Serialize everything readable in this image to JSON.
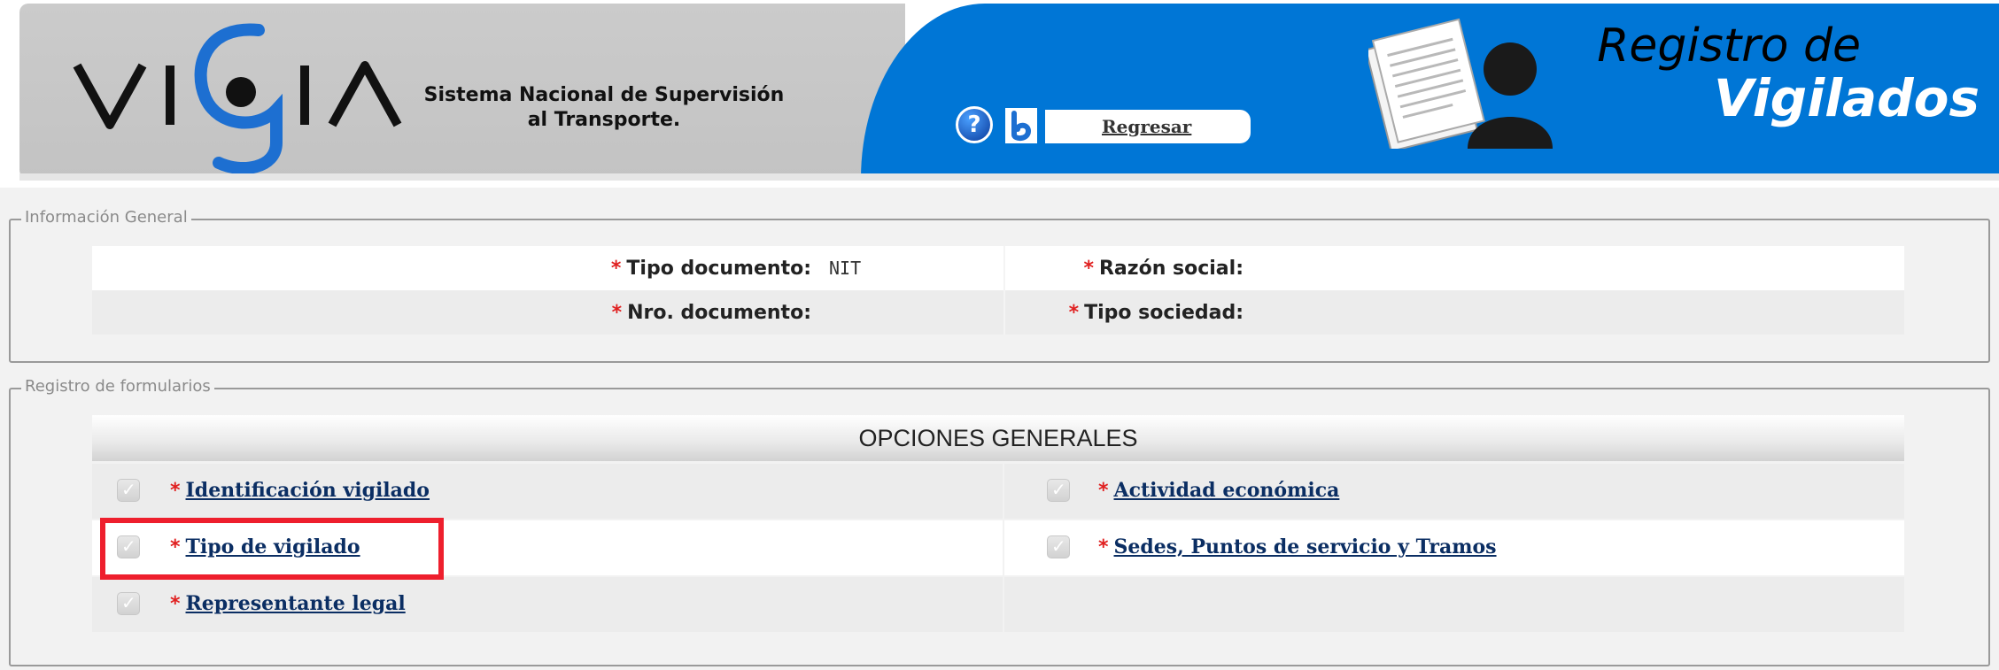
{
  "header": {
    "logo_text": "VIGIA",
    "system_title_line1": "Sistema Nacional de Supervisión",
    "system_title_line2": "al Transporte.",
    "help_label": "?",
    "back_label": "Regresar",
    "register_title_line1": "Registro de",
    "register_title_line2": "Vigilados",
    "colors": {
      "blue": "#0076d6",
      "gray": "#c7c7c7"
    },
    "icons": [
      "help-icon",
      "back-icon",
      "document-user-icon"
    ]
  },
  "info_general": {
    "legend": "Información General",
    "rows": [
      {
        "left_label": "Tipo documento:",
        "left_value": "NIT",
        "right_label": "Razón social:",
        "right_value": ""
      },
      {
        "left_label": "Nro. documento:",
        "left_value": "",
        "right_label": "Tipo sociedad:",
        "right_value": ""
      }
    ],
    "required_mark": "*"
  },
  "forms": {
    "legend": "Registro de formularios",
    "header": "OPCIONES GENERALES",
    "required_mark": "*",
    "left_options": [
      {
        "label": "Identificación vigilado",
        "checked": true
      },
      {
        "label": "Tipo de vigilado",
        "checked": true,
        "highlighted": true
      },
      {
        "label": "Representante legal",
        "checked": true
      }
    ],
    "right_options": [
      {
        "label": "Actividad económica",
        "checked": true
      },
      {
        "label": "Sedes, Puntos de servicio y Tramos",
        "checked": true
      }
    ],
    "highlight_color": "#ee1f2d"
  }
}
